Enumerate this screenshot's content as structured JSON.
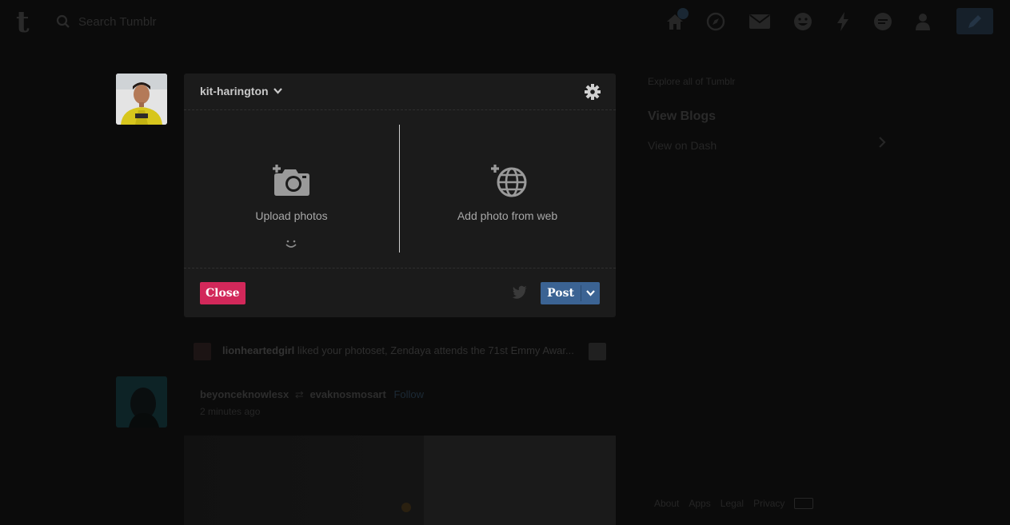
{
  "topbar": {
    "logo": "t",
    "search_placeholder": "Search Tumblr",
    "icons": [
      "home-icon",
      "explore-icon",
      "mail-icon",
      "emoji-icon",
      "activity-icon",
      "chat-icon",
      "account-icon",
      "compose-icon"
    ]
  },
  "editor": {
    "blog_name": "kit-harington",
    "upload_label": "Upload photos",
    "web_label": "Add photo from web",
    "close_label": "Close",
    "post_label": "Post"
  },
  "dashboard": {
    "notification": {
      "user": "lionheartedgirl",
      "text": "liked your photoset, Zendaya attends the 71st Emmy Awar..."
    },
    "post": {
      "author": "beyonceknowlesx",
      "reblogged_from": "evaknosmosart",
      "follow_label": "Follow",
      "time": "2 minutes ago"
    }
  },
  "sidebar": {
    "explore": "Explore all of Tumblr",
    "view_blogs": "View Blogs",
    "view_dash": "View on Dash"
  },
  "footer": {
    "links": [
      "About",
      "Apps",
      "Legal",
      "Privacy"
    ]
  },
  "colors": {
    "close_button": "#d2285a",
    "post_button": "#3b6393",
    "editor_bg": "#1b1b1b",
    "page_bg": "#0b0b0b"
  }
}
